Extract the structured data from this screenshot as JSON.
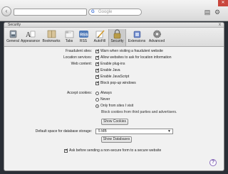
{
  "browser": {
    "search_placeholder": "Google",
    "search_engine_letter": "G"
  },
  "window": {
    "title": "Security",
    "close_glyph": "x"
  },
  "toolbar": {
    "items": [
      {
        "label": "General",
        "icon": "general-switch-icon"
      },
      {
        "label": "Appearance",
        "icon": "appearance-icon"
      },
      {
        "label": "Bookmarks",
        "icon": "bookmarks-icon"
      },
      {
        "label": "Tabs",
        "icon": "tabs-icon"
      },
      {
        "label": "RSS",
        "icon": "rss-icon"
      },
      {
        "label": "AutoFill",
        "icon": "autofill-pencil-icon"
      },
      {
        "label": "Security",
        "icon": "lock-icon",
        "active": true
      },
      {
        "label": "Extensions",
        "icon": "extensions-icon"
      },
      {
        "label": "Advanced",
        "icon": "gear-icon"
      }
    ],
    "rss_text": "RSS"
  },
  "security": {
    "fraudulent_label": "Fraudulent sites:",
    "fraudulent_option": "Warn when visiting a fraudulent website",
    "location_label": "Location services:",
    "location_option": "Allow websites to ask for location information",
    "web_content_label": "Web content:",
    "web_content_options": [
      "Enable plug-ins",
      "Enable Java",
      "Enable JavaScript",
      "Block pop-up windows"
    ],
    "cookies_label": "Accept cookies:",
    "cookie_options": [
      "Always",
      "Never",
      "Only from sites I visit"
    ],
    "cookie_selected": "Only from sites I visit",
    "cookie_note": "Block cookies from third parties and advertisers.",
    "show_cookies_button": "Show Cookies",
    "db_label": "Default space for database storage:",
    "db_value": "5 MB",
    "show_databases_button": "Show Databases",
    "non_secure_option": "Ask before sending a non-secure form to a secure website",
    "help_glyph": "?"
  }
}
